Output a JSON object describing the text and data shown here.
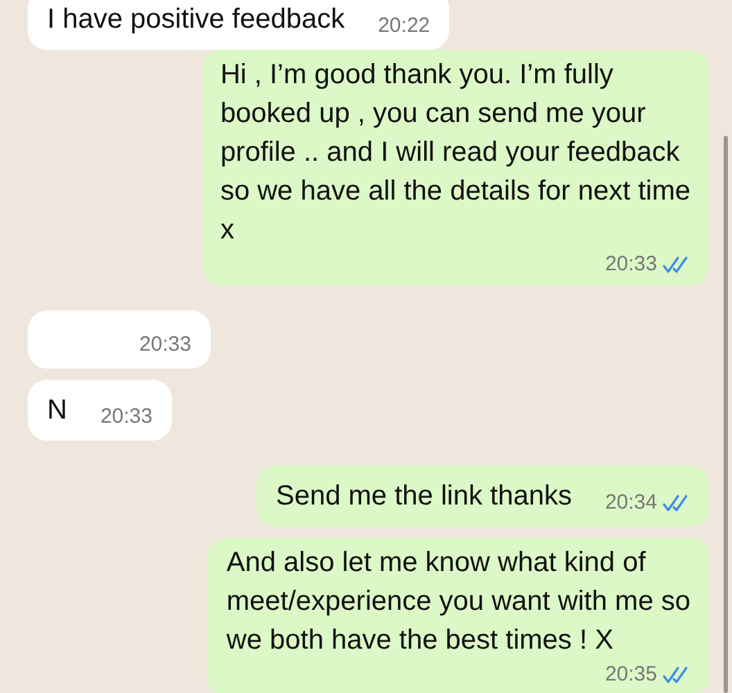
{
  "messages": [
    {
      "outgoing": false,
      "lines": [
        "I have positive feedback"
      ],
      "time": "20:22"
    },
    {
      "outgoing": true,
      "lines": [
        "Hi , I’m good thank you. I’m fully",
        "booked up , you can send me your",
        "profile .. and I will read your feedback",
        "so we have all the details for next time",
        "x"
      ],
      "time": "20:33",
      "read": true
    },
    {
      "outgoing": false,
      "time": "20:33"
    },
    {
      "outgoing": false,
      "lines": [
        "N"
      ],
      "time": "20:33"
    },
    {
      "outgoing": true,
      "lines": [
        "Send me the link thanks"
      ],
      "time": "20:34",
      "read": true
    },
    {
      "outgoing": true,
      "lines": [
        "And also let me know what kind of",
        "meet/experience you want with me  so",
        "we both have the best times ! X"
      ],
      "time": "20:35",
      "read": true
    }
  ]
}
